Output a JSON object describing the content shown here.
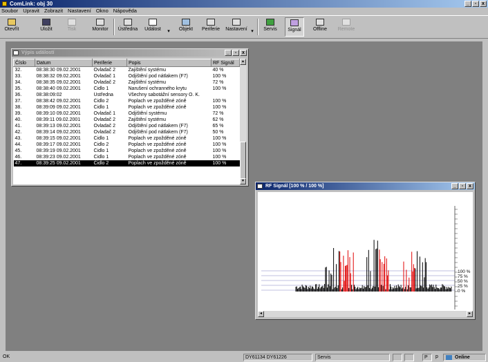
{
  "app": {
    "title": "ComLink: obj 30"
  },
  "menu": [
    "Soubor",
    "Upravit",
    "Zobrazit",
    "Nastavení",
    "Okno",
    "Nápověda"
  ],
  "toolbar": {
    "open": "Otevřít",
    "save": "Uložit",
    "print": "Tisk",
    "monitor": "Monitor",
    "panel": "Ústředna",
    "event": "Událost",
    "object": "Objekt",
    "periph": "Periferie",
    "settings": "Nastavení",
    "service": "Servis",
    "signal": "Signál",
    "offline": "Offline",
    "remote": "Remote"
  },
  "events": {
    "title": "Výpis událostí",
    "columns": [
      "Číslo",
      "Datum",
      "Periferie",
      "Popis",
      "RF Signál"
    ],
    "rows": [
      [
        "32.",
        "08:38:30 09.02.2001",
        "Ovladač 2",
        "Zajištění systému",
        "40 %"
      ],
      [
        "33.",
        "08:38:32 09.02.2001",
        "Ovladač 1",
        "Odjištění pod nátlakem (F7)",
        "100 %"
      ],
      [
        "34.",
        "08:38:35 09.02.2001",
        "Ovladač 2",
        "Zajištění systému",
        "72 %"
      ],
      [
        "35.",
        "08:38:40 09.02.2001",
        "Čidlo 1",
        "Narušení ochranného krytu",
        "100 %"
      ],
      [
        "36.",
        "08:38:09:02",
        "Ústředna",
        "Všechny sabotážní sensory O. K.",
        ""
      ],
      [
        "37.",
        "08:38:42 09.02.2001",
        "Čidlo 2",
        "Poplach ve zpožděné zóně",
        "100 %"
      ],
      [
        "38.",
        "08:39:09 09.02.2001",
        "Čidlo 1",
        "Poplach ve zpožděné zóně",
        "100 %"
      ],
      [
        "39.",
        "08:39:10 09.02.2001",
        "Ovladač 1",
        "Odjištění systému",
        "72 %"
      ],
      [
        "40.",
        "08:39:11 09.02.2001",
        "Ovladač 2",
        "Zajištění systému",
        "62 %"
      ],
      [
        "41.",
        "08:39:13 09.02.2001",
        "Ovladač 2",
        "Odjištění pod nátlakem (F7)",
        "65 %"
      ],
      [
        "42.",
        "08:39:14 09.02.2001",
        "Ovladač 2",
        "Odjištění pod nátlakem (F7)",
        "50 %"
      ],
      [
        "43.",
        "08:39:15 09.02.2001",
        "Čidlo 1",
        "Poplach ve zpožděné zóně",
        "100 %"
      ],
      [
        "44.",
        "08:39:17 09.02.2001",
        "Čidlo 2",
        "Poplach ve zpožděné zóně",
        "100 %"
      ],
      [
        "45.",
        "08:39:19 09.02.2001",
        "Čidlo 1",
        "Poplach ve zpožděné zóně",
        "100 %"
      ],
      [
        "46.",
        "08:39:23 09.02.2001",
        "Čidlo 1",
        "Poplach ve zpožděné zóně",
        "100 %"
      ],
      [
        "47.",
        "08:39:25 09.02.2001",
        "Čidlo 2",
        "Poplach ve zpožděné zóně",
        "100 %"
      ]
    ],
    "selected_row": 15
  },
  "rf": {
    "title": "RF Signál [100 % / 100 %]",
    "ticks": [
      "100 %",
      "75 %",
      "50 %",
      "25 %",
      "0 %"
    ]
  },
  "status": {
    "left": "OK",
    "ids": "DY61134  DY61226",
    "mode": "Servis",
    "p1": "P",
    "p2": "p",
    "online": "Online"
  },
  "colors": {
    "series_a": "#000000",
    "series_b": "#e00000",
    "gridline": "#8080c0"
  }
}
